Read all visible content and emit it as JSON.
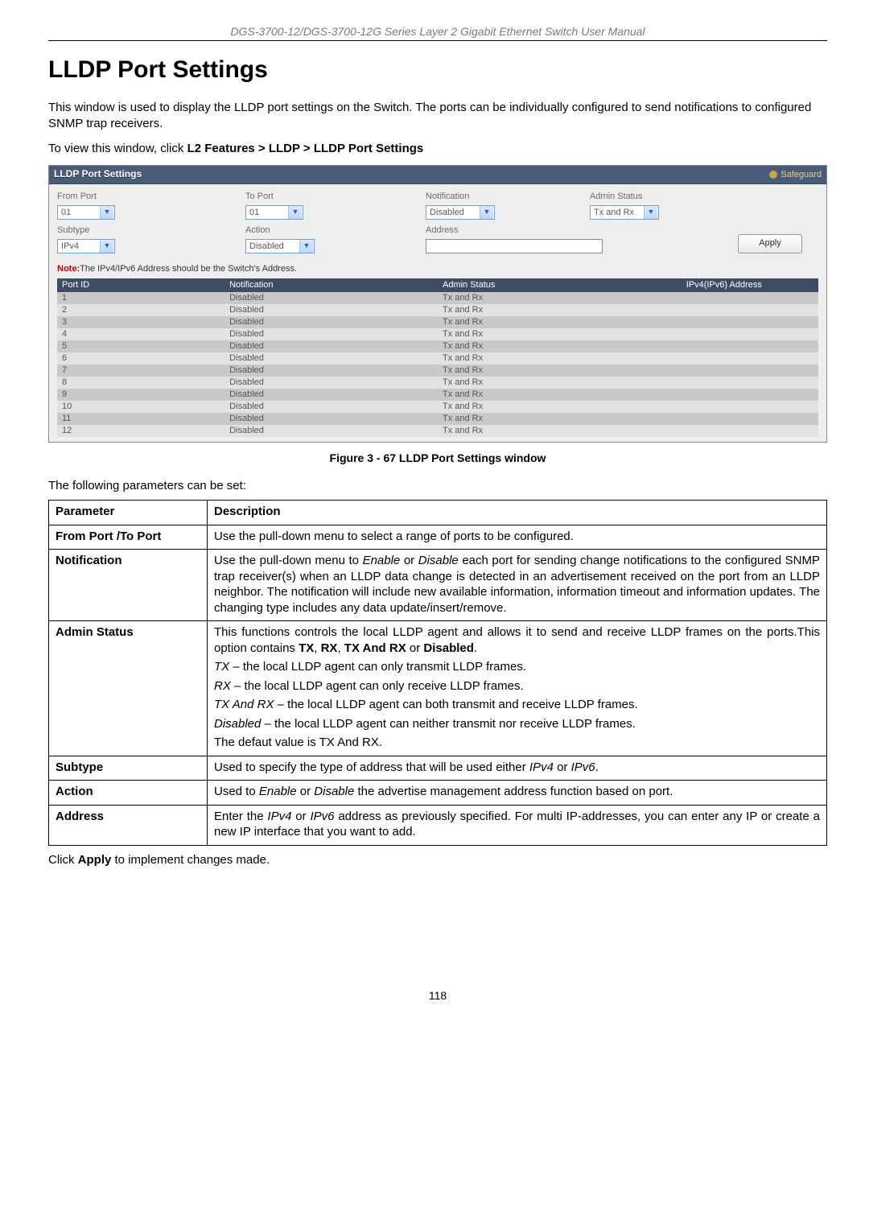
{
  "header_text": "DGS-3700-12/DGS-3700-12G Series Layer 2 Gigabit Ethernet Switch User Manual",
  "main_title": "LLDP Port Settings",
  "intro_text": "This window is used to display the LLDP port settings on the Switch. The ports can be individually configured to send notifications to configured SNMP trap receivers.",
  "breadcrumb_prefix": "To view this window, click ",
  "breadcrumb_bold": "L2 Features > LLDP > LLDP Port Settings",
  "window": {
    "title": "LLDP Port Settings",
    "safeguard_label": "Safeguard",
    "labels": {
      "from_port": "From Port",
      "to_port": "To Port",
      "notification": "Notification",
      "admin_status": "Admin Status",
      "subtype": "Subtype",
      "action": "Action",
      "address": "Address"
    },
    "values": {
      "from_port": "01",
      "to_port": "01",
      "notification": "Disabled",
      "admin_status": "Tx and Rx",
      "subtype": "IPv4",
      "action": "Disabled",
      "address": ""
    },
    "apply_label": "Apply",
    "note_bold": "Note:",
    "note_text": "The IPv4/IPv6 Address should be the Switch's Address.",
    "columns": [
      "Port ID",
      "Notification",
      "Admin Status",
      "IPv4(IPv6) Address"
    ],
    "rows": [
      {
        "port_id": "1",
        "notification": "Disabled",
        "admin_status": "Tx and Rx",
        "addr": ""
      },
      {
        "port_id": "2",
        "notification": "Disabled",
        "admin_status": "Tx and Rx",
        "addr": ""
      },
      {
        "port_id": "3",
        "notification": "Disabled",
        "admin_status": "Tx and Rx",
        "addr": ""
      },
      {
        "port_id": "4",
        "notification": "Disabled",
        "admin_status": "Tx and Rx",
        "addr": ""
      },
      {
        "port_id": "5",
        "notification": "Disabled",
        "admin_status": "Tx and Rx",
        "addr": ""
      },
      {
        "port_id": "6",
        "notification": "Disabled",
        "admin_status": "Tx and Rx",
        "addr": ""
      },
      {
        "port_id": "7",
        "notification": "Disabled",
        "admin_status": "Tx and Rx",
        "addr": ""
      },
      {
        "port_id": "8",
        "notification": "Disabled",
        "admin_status": "Tx and Rx",
        "addr": ""
      },
      {
        "port_id": "9",
        "notification": "Disabled",
        "admin_status": "Tx and Rx",
        "addr": ""
      },
      {
        "port_id": "10",
        "notification": "Disabled",
        "admin_status": "Tx and Rx",
        "addr": ""
      },
      {
        "port_id": "11",
        "notification": "Disabled",
        "admin_status": "Tx and Rx",
        "addr": ""
      },
      {
        "port_id": "12",
        "notification": "Disabled",
        "admin_status": "Tx and Rx",
        "addr": ""
      }
    ]
  },
  "figure_caption": "Figure 3 - 67 LLDP Port Settings window",
  "after_figure_text": "The following parameters can be set:",
  "param_table": {
    "head_param": "Parameter",
    "head_desc": "Description",
    "rows": [
      {
        "name": "From Port /To Port",
        "desc_html": "Use the pull-down menu to select a range of ports to be configured."
      },
      {
        "name": "Notification",
        "desc_html": "Use the pull-down menu to <span class=\"italic\">Enable</span> or <span class=\"italic\">Disable</span> each port for sending change notifications to the configured SNMP trap receiver(s) when an LLDP data change is detected in an advertisement received on the port from an LLDP neighbor. The notification will include new available information, information timeout and information updates. The changing type includes any data update/insert/remove."
      },
      {
        "name": "Admin Status",
        "desc_html": "<p>This functions controls the local LLDP agent and allows it to send and receive LLDP frames on the ports.This option contains <span class=\"bold\">TX</span>, <span class=\"bold\">RX</span>, <span class=\"bold\">TX And RX</span> or <span class=\"bold\">Disabled</span>.</p><p><span class=\"italic\">TX</span> – the local LLDP agent can only transmit LLDP frames.</p><p><span class=\"italic\">RX</span> – the local LLDP agent can only receive LLDP frames.</p><p><span class=\"italic\">TX And RX</span> – the local LLDP agent can both transmit and receive LLDP frames.</p><p><span class=\"italic\">Disabled</span> – the local LLDP agent can neither transmit nor receive LLDP frames.</p><p>The defaut value is TX And RX.</p>"
      },
      {
        "name": "Subtype",
        "desc_html": "Used to specify the type of address that will be used either <span class=\"italic\">IPv4</span> or <span class=\"italic\">IPv6</span>."
      },
      {
        "name": "Action",
        "desc_html": "Used to <span class=\"italic\">Enable</span> or <span class=\"italic\">Disable</span> the advertise management address function based on port."
      },
      {
        "name": "Address",
        "desc_html": "Enter the <span class=\"italic\">IPv4</span> or <span class=\"italic\">IPv6</span> address as previously specified. For multi IP-addresses, you can enter any IP or create a new IP interface that you want to add."
      }
    ]
  },
  "footer_text_prefix": "Click ",
  "footer_text_bold": "Apply",
  "footer_text_suffix": " to implement changes made.",
  "page_number": "118"
}
